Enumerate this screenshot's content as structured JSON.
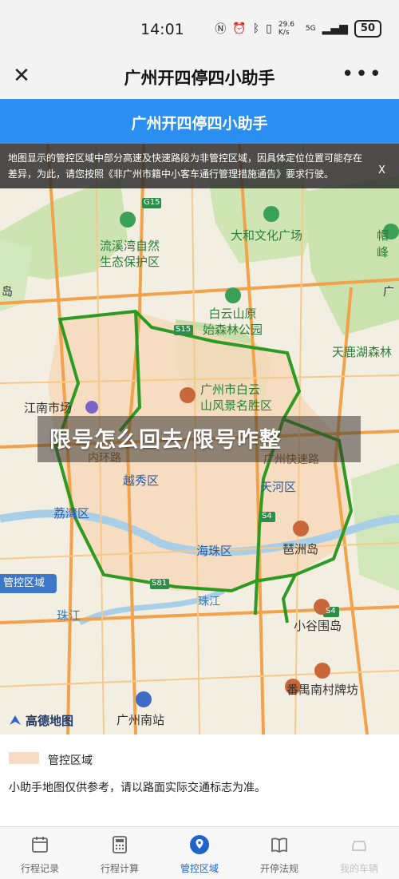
{
  "status_bar": {
    "time": "14:01",
    "net_speed": "29.6 K/s",
    "network": "5G",
    "battery": "50"
  },
  "header": {
    "title": "广州开四停四小助手"
  },
  "banner": {
    "title": "广州开四停四小助手"
  },
  "notice": {
    "text": "地图显示的管控区域中部分高速及快速路段为非管控区域，因具体定位位置可能存在差异，为此，请您按照《非广州市籍中小客车通行管理措施通告》要求行驶。",
    "close": "X"
  },
  "overlay_headline": "限号怎么回去/限号咋整",
  "map": {
    "control_tag": "管控区域",
    "provider": "高德地图",
    "road_shields": [
      "G15",
      "S15",
      "S4",
      "S81",
      "S4"
    ],
    "labels": {
      "liuxi": "流溪湾自然\n生态保护区",
      "dahe": "大和文化广场",
      "maofeng": "帽峰",
      "baiyun_forest": "白云山原\n始森林公园",
      "tianlu": "天鹿湖森林",
      "jiangnan": "江南市场",
      "baiyun_scenic": "广州市白云\n山风景名胜区",
      "guangzhou_expy": "广州快速路",
      "neihuan": "内环路",
      "yuexiu": "越秀区",
      "tianhe": "天河区",
      "liwan": "荔湾区",
      "pazhou": "琶洲岛",
      "haizhu": "海珠区",
      "zhujiang": "珠江",
      "zhujiang2": "珠江",
      "xiaogu": "小谷围岛",
      "panyu": "番禺南村牌坊",
      "south_station": "广州南站",
      "dao": "岛",
      "guang": "广"
    }
  },
  "legend": {
    "label": "管控区域",
    "note": "小助手地图仅供参考，请以路面实际交通标志为准。",
    "swatch_color": "#f6dcc2"
  },
  "nav": {
    "items": [
      {
        "label": "行程记录",
        "icon": "calendar-icon"
      },
      {
        "label": "行程计算",
        "icon": "calculator-icon"
      },
      {
        "label": "管控区域",
        "icon": "map-pin-icon"
      },
      {
        "label": "开停法规",
        "icon": "book-icon"
      },
      {
        "label": "我的车辆",
        "icon": "car-icon"
      }
    ],
    "active_color": "#1f64c9"
  }
}
